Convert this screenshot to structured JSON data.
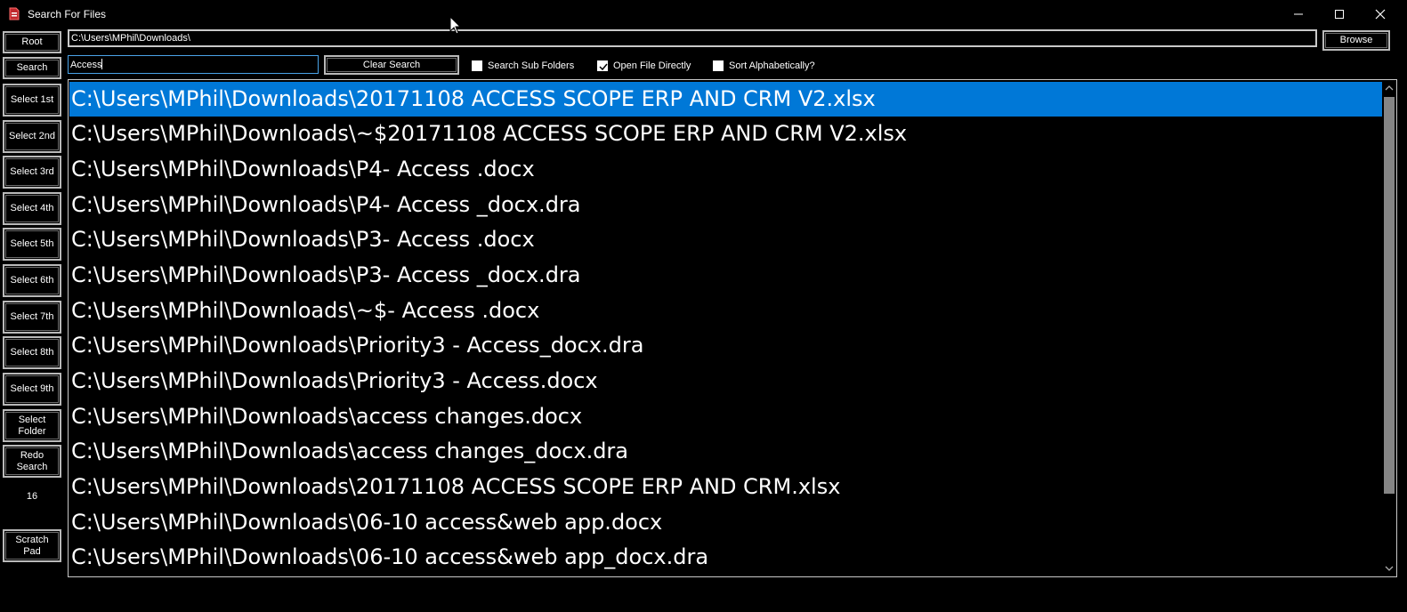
{
  "window": {
    "title": "Search For Files",
    "app_icon": "document-red-icon",
    "controls": [
      "minimize-icon",
      "maximize-icon",
      "close-icon"
    ]
  },
  "sidebar": {
    "buttons": [
      {
        "label": "Root"
      },
      {
        "label": "Search"
      },
      {
        "label": "Select 1st"
      },
      {
        "label": "Select 2nd"
      },
      {
        "label": "Select 3rd"
      },
      {
        "label": "Select 4th"
      },
      {
        "label": "Select 5th"
      },
      {
        "label": "Select 6th"
      },
      {
        "label": "Select 7th"
      },
      {
        "label": "Select 8th"
      },
      {
        "label": "Select 9th"
      },
      {
        "label": "Select Folder"
      },
      {
        "label": "Redo Search"
      }
    ],
    "result_count": "16",
    "scratch_pad": "Scratch Pad"
  },
  "toolbar": {
    "path_value": "C:\\Users\\MPhil\\Downloads\\",
    "browse_label": "Browse",
    "search_value": "Access",
    "clear_label": "Clear Search",
    "options": [
      {
        "label": "Search Sub  Folders",
        "checked": false
      },
      {
        "label": "Open File Directly",
        "checked": true
      },
      {
        "label": "Sort Alphabetically?",
        "checked": false
      }
    ]
  },
  "results": {
    "selected_index": 0,
    "items": [
      "C:\\Users\\MPhil\\Downloads\\20171108 ACCESS SCOPE ERP AND CRM V2.xlsx",
      "C:\\Users\\MPhil\\Downloads\\~$20171108 ACCESS SCOPE ERP AND CRM V2.xlsx",
      "C:\\Users\\MPhil\\Downloads\\P4- Access .docx",
      "C:\\Users\\MPhil\\Downloads\\P4- Access _docx.dra",
      "C:\\Users\\MPhil\\Downloads\\P3- Access .docx",
      "C:\\Users\\MPhil\\Downloads\\P3- Access _docx.dra",
      "C:\\Users\\MPhil\\Downloads\\~$- Access .docx",
      "C:\\Users\\MPhil\\Downloads\\Priority3 - Access_docx.dra",
      "C:\\Users\\MPhil\\Downloads\\Priority3 - Access.docx",
      "C:\\Users\\MPhil\\Downloads\\access changes.docx",
      "C:\\Users\\MPhil\\Downloads\\access changes_docx.dra",
      "C:\\Users\\MPhil\\Downloads\\20171108 ACCESS SCOPE ERP AND CRM.xlsx",
      "C:\\Users\\MPhil\\Downloads\\06-10 access&web app.docx",
      "C:\\Users\\MPhil\\Downloads\\06-10 access&web app_docx.dra"
    ]
  },
  "colors": {
    "selection": "#0078d7",
    "background": "#000000",
    "text": "#ffffff",
    "scroll_thumb": "#858585"
  }
}
